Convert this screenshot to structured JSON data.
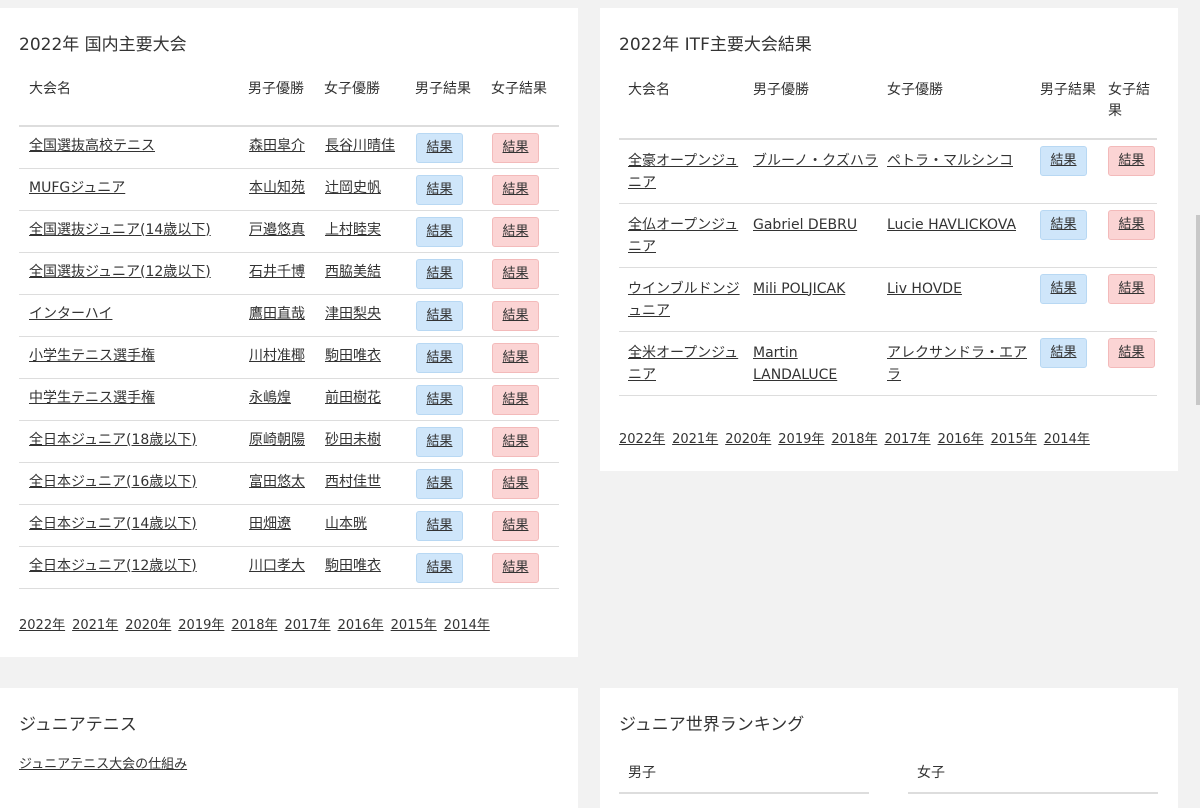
{
  "domestic": {
    "title": "2022年 国内主要大会",
    "headers": [
      "大会名",
      "男子優勝",
      "女子優勝",
      "男子結果",
      "女子結果"
    ],
    "result_label": "結果",
    "rows": [
      {
        "name": "全国選抜高校テニス",
        "men": "森田皐介",
        "women": "長谷川晴佳"
      },
      {
        "name": "MUFGジュニア",
        "men": "本山知苑",
        "women": "辻岡史帆"
      },
      {
        "name": "全国選抜ジュニア(14歳以下)",
        "men": "戸邉悠真",
        "women": "上村睦実"
      },
      {
        "name": "全国選抜ジュニア(12歳以下)",
        "men": "石井千博",
        "women": "西脇美結"
      },
      {
        "name": "インターハイ",
        "men": "鷹田直哉",
        "women": "津田梨央"
      },
      {
        "name": "小学生テニス選手権",
        "men": "川村准椰",
        "women": "駒田唯衣"
      },
      {
        "name": "中学生テニス選手権",
        "men": "永嶋煌",
        "women": "前田樹花"
      },
      {
        "name": "全日本ジュニア(18歳以下)",
        "men": "原崎朝陽",
        "women": "砂田未樹"
      },
      {
        "name": "全日本ジュニア(16歳以下)",
        "men": "富田悠太",
        "women": "西村佳世"
      },
      {
        "name": "全日本ジュニア(14歳以下)",
        "men": "田畑遼",
        "women": "山本晄"
      },
      {
        "name": "全日本ジュニア(12歳以下)",
        "men": "川口孝大",
        "women": "駒田唯衣"
      }
    ],
    "years": [
      "2022年",
      "2021年",
      "2020年",
      "2019年",
      "2018年",
      "2017年",
      "2016年",
      "2015年",
      "2014年"
    ]
  },
  "itf": {
    "title": "2022年 ITF主要大会結果",
    "headers": [
      "大会名",
      "男子優勝",
      "女子優勝",
      "男子結果",
      "女子結果"
    ],
    "result_label": "結果",
    "rows": [
      {
        "name": "全豪オープンジュニア",
        "men": "ブルーノ・クズハラ",
        "women": "ペトラ・マルシンコ"
      },
      {
        "name": "全仏オープンジュニア",
        "men": "Gabriel DEBRU",
        "women": "Lucie HAVLICKOVA"
      },
      {
        "name": "ウインブルドンジュニア",
        "men": "Mili POLJICAK",
        "women": "Liv HOVDE"
      },
      {
        "name": "全米オープンジュニア",
        "men": "Martin LANDALUCE",
        "women": "アレクサンドラ・エアラ"
      }
    ],
    "years": [
      "2022年",
      "2021年",
      "2020年",
      "2019年",
      "2018年",
      "2017年",
      "2016年",
      "2015年",
      "2014年"
    ]
  },
  "junior": {
    "title": "ジュニアテニス",
    "link": "ジュニアテニス大会の仕組み"
  },
  "ranking": {
    "title": "ジュニア世界ランキング",
    "male": "男子",
    "female": "女子"
  },
  "colors": {
    "men_button": "#cfe6fa",
    "women_button": "#fbd4d4"
  }
}
